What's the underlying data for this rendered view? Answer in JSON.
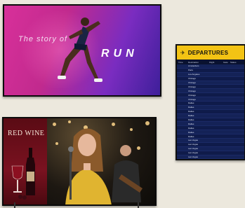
{
  "display_top": {
    "tagline": "The story of",
    "headline": "RUN"
  },
  "departures_board": {
    "title": "DEPARTURES",
    "icon": "plane-icon",
    "columns": [
      "Time",
      "Destination",
      "Flight",
      "Gate",
      "Status"
    ],
    "rows": [
      [
        "",
        "Amsterdam",
        "",
        "",
        ""
      ],
      [
        "",
        "Paris",
        "",
        "",
        ""
      ],
      [
        "",
        "Los Angeles",
        "",
        "",
        ""
      ],
      [
        "",
        "Chicago",
        "",
        "",
        ""
      ],
      [
        "",
        "Chicago",
        "",
        "",
        ""
      ],
      [
        "",
        "Chicago",
        "",
        "",
        ""
      ],
      [
        "",
        "Chicago",
        "",
        "",
        ""
      ],
      [
        "",
        "Chicago",
        "",
        "",
        ""
      ],
      [
        "",
        "Chicago",
        "",
        "",
        ""
      ],
      [
        "",
        "Dallas",
        "",
        "",
        ""
      ],
      [
        "",
        "Dallas",
        "",
        "",
        ""
      ],
      [
        "",
        "Dallas",
        "",
        "",
        ""
      ],
      [
        "",
        "Dallas",
        "",
        "",
        ""
      ],
      [
        "",
        "Dallas",
        "",
        "",
        ""
      ],
      [
        "",
        "Dallas",
        "",
        "",
        ""
      ],
      [
        "",
        "Dallas",
        "",
        "",
        ""
      ],
      [
        "",
        "Dallas",
        "",
        "",
        ""
      ],
      [
        "",
        "Dallas",
        "",
        "",
        ""
      ],
      [
        "",
        "Las Vegas",
        "",
        "",
        ""
      ],
      [
        "",
        "Las Vegas",
        "",
        "",
        ""
      ],
      [
        "",
        "Las Vegas",
        "",
        "",
        ""
      ],
      [
        "",
        "Las Vegas",
        "",
        "",
        ""
      ],
      [
        "",
        "Las Vegas",
        "",
        "",
        ""
      ],
      [
        "",
        "Las Vegas",
        "",
        "",
        ""
      ]
    ]
  },
  "display_bottom": {
    "promo_title": "RED WINE"
  },
  "colors": {
    "background": "#ece8dd",
    "board_header": "#f3c314",
    "board_body": "#0c1740"
  }
}
